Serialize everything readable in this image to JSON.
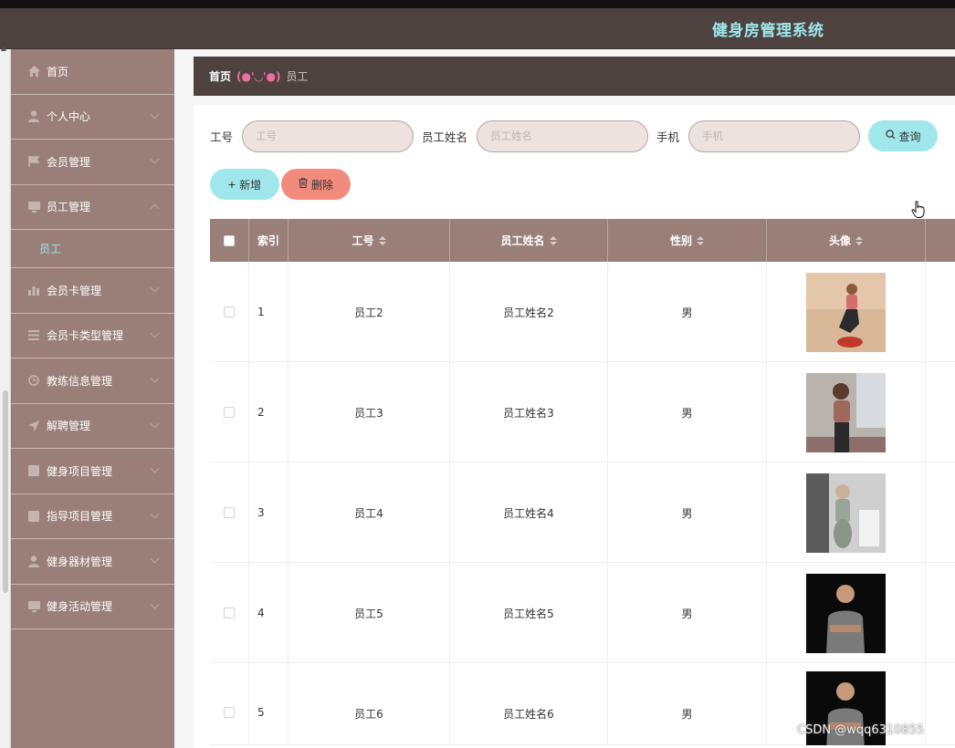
{
  "header": {
    "title": "健身房管理系统"
  },
  "sidebar": {
    "items": [
      {
        "label": "首页",
        "icon": "home-icon"
      },
      {
        "label": "个人中心",
        "icon": "user-icon"
      },
      {
        "label": "会员管理",
        "icon": "flag-icon"
      },
      {
        "label": "员工管理",
        "icon": "monitor-icon"
      },
      {
        "label": "会员卡管理",
        "icon": "chart-icon"
      },
      {
        "label": "会员卡类型管理",
        "icon": "list-icon"
      },
      {
        "label": "教练信息管理",
        "icon": "clock-icon"
      },
      {
        "label": "解聘管理",
        "icon": "send-icon"
      },
      {
        "label": "健身项目管理",
        "icon": "grid-icon"
      },
      {
        "label": "指导项目管理",
        "icon": "grid-icon"
      },
      {
        "label": "健身器材管理",
        "icon": "user-icon"
      },
      {
        "label": "健身活动管理",
        "icon": "monitor-icon"
      }
    ],
    "submenu": {
      "label": "员工"
    }
  },
  "breadcrumb": {
    "home": "首页",
    "separator": "(●'◡'●)",
    "current": "员工"
  },
  "search": {
    "fields": [
      {
        "label": "工号",
        "placeholder": "工号"
      },
      {
        "label": "员工姓名",
        "placeholder": "员工姓名"
      },
      {
        "label": "手机",
        "placeholder": "手机"
      }
    ],
    "query_label": "查询"
  },
  "actions": {
    "add_label": "新增",
    "delete_label": "删除"
  },
  "table": {
    "columns": [
      "索引",
      "工号",
      "员工姓名",
      "性别",
      "头像"
    ],
    "rows": [
      {
        "index": "1",
        "emp_no": "员工2",
        "name": "员工姓名2",
        "gender": "男"
      },
      {
        "index": "2",
        "emp_no": "员工3",
        "name": "员工姓名3",
        "gender": "男"
      },
      {
        "index": "3",
        "emp_no": "员工4",
        "name": "员工姓名4",
        "gender": "男"
      },
      {
        "index": "4",
        "emp_no": "员工5",
        "name": "员工姓名5",
        "gender": "男"
      },
      {
        "index": "5",
        "emp_no": "员工6",
        "name": "员工姓名6",
        "gender": "男"
      }
    ]
  },
  "watermark": "CSDN @wqq6310855",
  "colors": {
    "header_bg": "#4d4240",
    "sidebar_bg": "#9a7f79",
    "accent": "#9fe7ea",
    "danger": "#f28b7b",
    "input_bg": "#ece2e0"
  }
}
